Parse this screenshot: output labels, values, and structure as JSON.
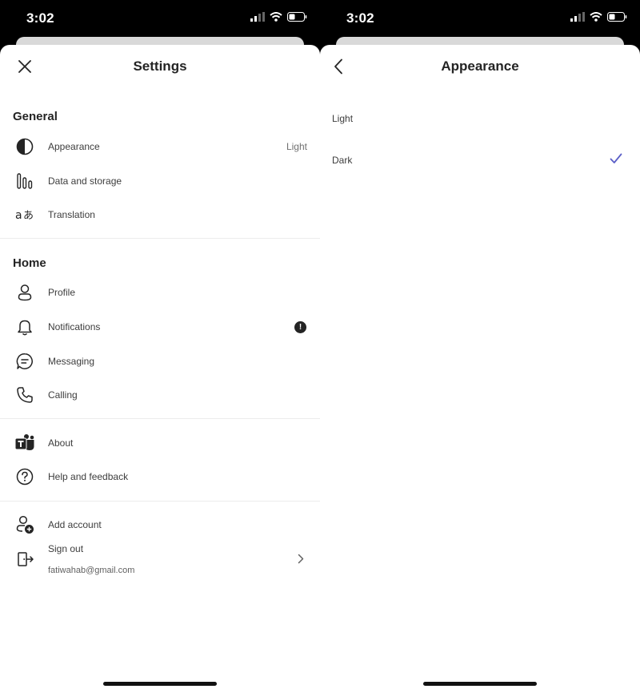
{
  "status_bar": {
    "time": "3:02"
  },
  "settings": {
    "title": "Settings",
    "sections": {
      "general": {
        "header": "General",
        "items": [
          {
            "label": "Appearance",
            "value": "Light",
            "icon": "half-circle-icon"
          },
          {
            "label": "Data and storage",
            "icon": "bar-chart-icon"
          },
          {
            "label": "Translation",
            "icon": "translate-icon"
          }
        ]
      },
      "home": {
        "header": "Home",
        "items": [
          {
            "label": "Profile",
            "icon": "person-icon"
          },
          {
            "label": "Notifications",
            "icon": "bell-icon",
            "badge": "!"
          },
          {
            "label": "Messaging",
            "icon": "chat-icon"
          },
          {
            "label": "Calling",
            "icon": "phone-icon"
          }
        ]
      },
      "more": {
        "items": [
          {
            "label": "About",
            "icon": "teams-logo-icon"
          },
          {
            "label": "Help and feedback",
            "icon": "question-icon"
          }
        ]
      },
      "account": {
        "add_account": "Add account",
        "sign_out": "Sign out",
        "email": "fatiwahab@gmail.com"
      }
    }
  },
  "appearance": {
    "title": "Appearance",
    "options": [
      "Light",
      "Dark"
    ],
    "selected": "Dark",
    "accent_color": "#5b5fc7"
  }
}
